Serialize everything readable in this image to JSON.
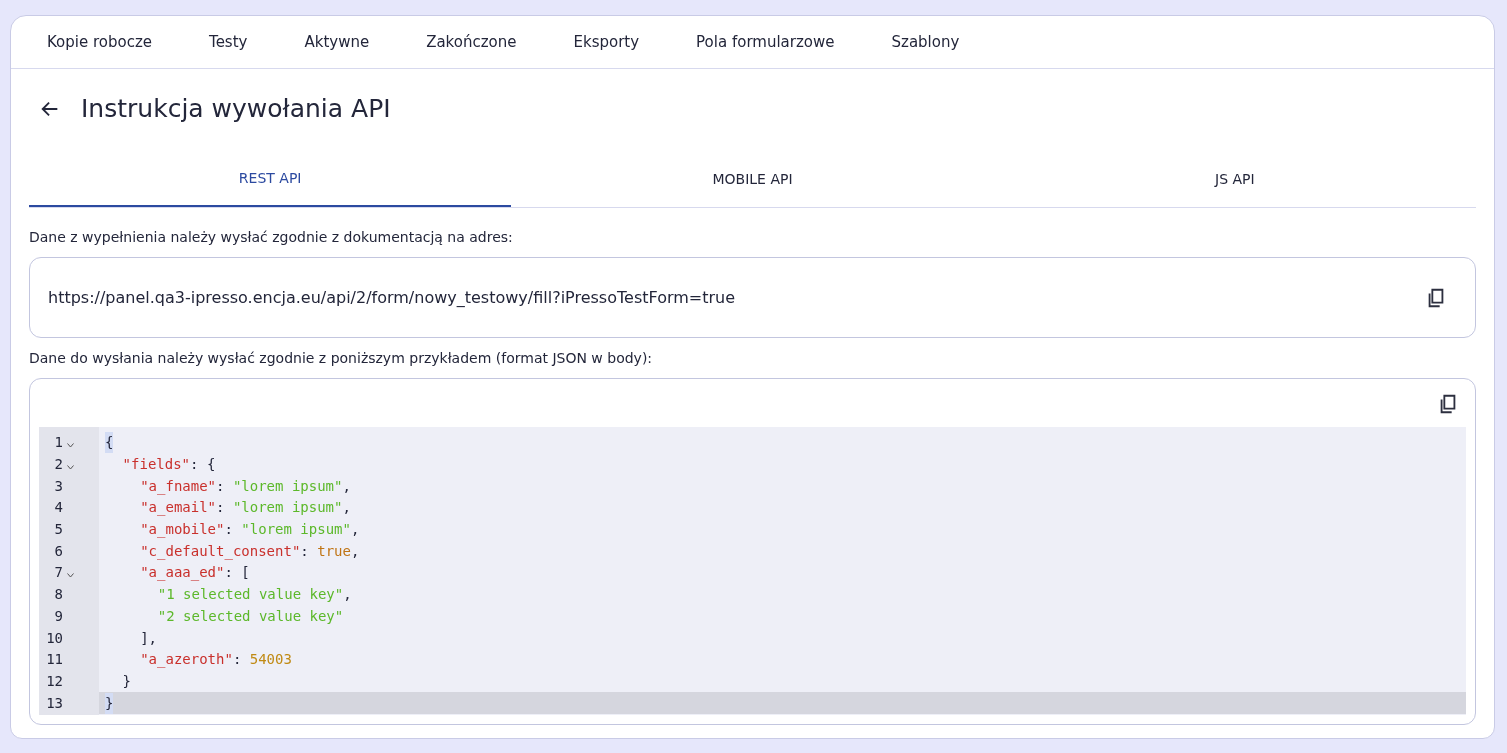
{
  "nav": [
    {
      "label": "Kopie robocze"
    },
    {
      "label": "Testy"
    },
    {
      "label": "Aktywne"
    },
    {
      "label": "Zakończone"
    },
    {
      "label": "Eksporty"
    },
    {
      "label": "Pola formularzowe"
    },
    {
      "label": "Szablony"
    }
  ],
  "page_title": "Instrukcja wywołania API",
  "api_tabs": [
    {
      "label": "REST API",
      "selected": true
    },
    {
      "label": "MOBILE API",
      "selected": false
    },
    {
      "label": "JS API",
      "selected": false
    }
  ],
  "url_label": "Dane z wypełnienia należy wysłać zgodnie z dokumentacją na adres:",
  "url": "https://panel.qa3-ipresso.encja.eu/api/2/form/nowy_testowy/fill?iPressoTestForm=true",
  "body_label": "Dane do wysłania należy wysłać zgodnie z poniższym przykładem (format JSON w body):",
  "code_lines": [
    {
      "number": "1",
      "foldable": true,
      "active": false,
      "tokens": [
        {
          "kind": "bracket",
          "text": "{"
        }
      ]
    },
    {
      "number": "2",
      "foldable": true,
      "active": false,
      "tokens": [
        {
          "kind": "key",
          "text": "\"fields\""
        },
        {
          "kind": "punct",
          "text": ": {"
        }
      ]
    },
    {
      "number": "3",
      "foldable": false,
      "active": false,
      "tokens": [
        {
          "kind": "key",
          "text": "\"a_fname\""
        },
        {
          "kind": "punct",
          "text": ": "
        },
        {
          "kind": "string",
          "text": "\"lorem ipsum\""
        },
        {
          "kind": "punct",
          "text": ","
        }
      ]
    },
    {
      "number": "4",
      "foldable": false,
      "active": false,
      "tokens": [
        {
          "kind": "key",
          "text": "\"a_email\""
        },
        {
          "kind": "punct",
          "text": ": "
        },
        {
          "kind": "string",
          "text": "\"lorem ipsum\""
        },
        {
          "kind": "punct",
          "text": ","
        }
      ]
    },
    {
      "number": "5",
      "foldable": false,
      "active": false,
      "tokens": [
        {
          "kind": "key",
          "text": "\"a_mobile\""
        },
        {
          "kind": "punct",
          "text": ": "
        },
        {
          "kind": "string",
          "text": "\"lorem ipsum\""
        },
        {
          "kind": "punct",
          "text": ","
        }
      ]
    },
    {
      "number": "6",
      "foldable": false,
      "active": false,
      "tokens": [
        {
          "kind": "key",
          "text": "\"c_default_consent\""
        },
        {
          "kind": "punct",
          "text": ": "
        },
        {
          "kind": "literal",
          "text": "true"
        },
        {
          "kind": "punct",
          "text": ","
        }
      ]
    },
    {
      "number": "7",
      "foldable": true,
      "active": false,
      "tokens": [
        {
          "kind": "key",
          "text": "\"a_aaa_ed\""
        },
        {
          "kind": "punct",
          "text": ": ["
        }
      ]
    },
    {
      "number": "8",
      "foldable": false,
      "active": false,
      "tokens": [
        {
          "kind": "string",
          "text": "\"1 selected value key\""
        },
        {
          "kind": "punct",
          "text": ","
        }
      ]
    },
    {
      "number": "9",
      "foldable": false,
      "active": false,
      "tokens": [
        {
          "kind": "string",
          "text": "\"2 selected value key\""
        }
      ]
    },
    {
      "number": "10",
      "foldable": false,
      "active": false,
      "tokens": [
        {
          "kind": "punct",
          "text": "],"
        }
      ]
    },
    {
      "number": "11",
      "foldable": false,
      "active": false,
      "tokens": [
        {
          "kind": "key",
          "text": "\"a_azeroth\""
        },
        {
          "kind": "punct",
          "text": ": "
        },
        {
          "kind": "number",
          "text": "54003"
        }
      ]
    },
    {
      "number": "12",
      "foldable": false,
      "active": false,
      "tokens": [
        {
          "kind": "punct",
          "text": "}"
        }
      ]
    },
    {
      "number": "13",
      "foldable": false,
      "active": true,
      "tokens": [
        {
          "kind": "bracket",
          "text": "}"
        }
      ]
    }
  ]
}
